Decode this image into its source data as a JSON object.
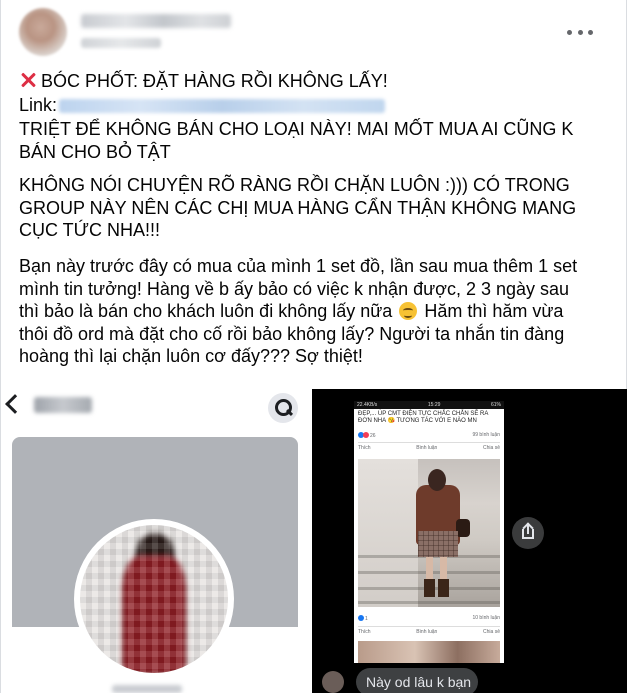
{
  "post": {
    "line_title": "BÓC PHỐT: ĐẶT HÀNG RỒI KHÔNG LẤY!",
    "line_link_label": "Link:",
    "paragraph_1": "TRIỆT ĐỂ KHÔNG BÁN CHO LOẠI NÀY! MAI MỐT MUA AI CŨNG K\nBÁN CHO BỎ TẬT",
    "paragraph_2": "KHÔNG NÓI CHUYỆN RÕ RÀNG RỒI CHẶN LUÔN :))) CÓ TRONG\nGROUP NÀY NÊN CÁC CHỊ MUA HÀNG CẨN THẬN KHÔNG MANG\nCỤC TỨC NHA!!!",
    "paragraph_3a": "Bạn này trước đây có mua của mình 1 set đồ, lần sau mua thêm 1 set\nmình tin tưởng! Hàng về b ấy bảo có việc k nhận được, 2 3 ngày sau\nthì bảo là bán cho khách luôn đi không lấy nữa ",
    "paragraph_3b": " Hăm thì hăm vừa\nthôi đồ ord mà đặt cho cố rồi bảo không lấy? Người ta nhắn tin đàng\nhoàng thì lại chặn luôn cơ đấy??? Sợ thiệt!",
    "icons": {
      "title_icon": "cross-mark-icon",
      "emoji": "smirking-face-icon",
      "more": "more-options-icon"
    }
  },
  "right_shot": {
    "status_left": "22.4KB/s",
    "status_time": "15:29",
    "status_right": "61%",
    "caption": "ĐẸP,... ÚP CMT ĐIỆN TỰC CHẮC CHẮN SẼ RA ĐƠN NHA 😘 TƯƠNG TÁC VỚI E NÀO MN",
    "reactions_count_1": "26",
    "comments_count_1": "99 bình luận",
    "reactions_count_2": "1",
    "comments_count_2": "10 bình luận",
    "action_like": "Thích",
    "action_comment": "Bình luận",
    "action_share": "Chia sẻ",
    "message": "Này od lâu k bạn"
  },
  "colors": {
    "accent_red": "#dd2e44",
    "messenger_bubble": "#3e4042",
    "fb_blue": "#1877f2"
  }
}
